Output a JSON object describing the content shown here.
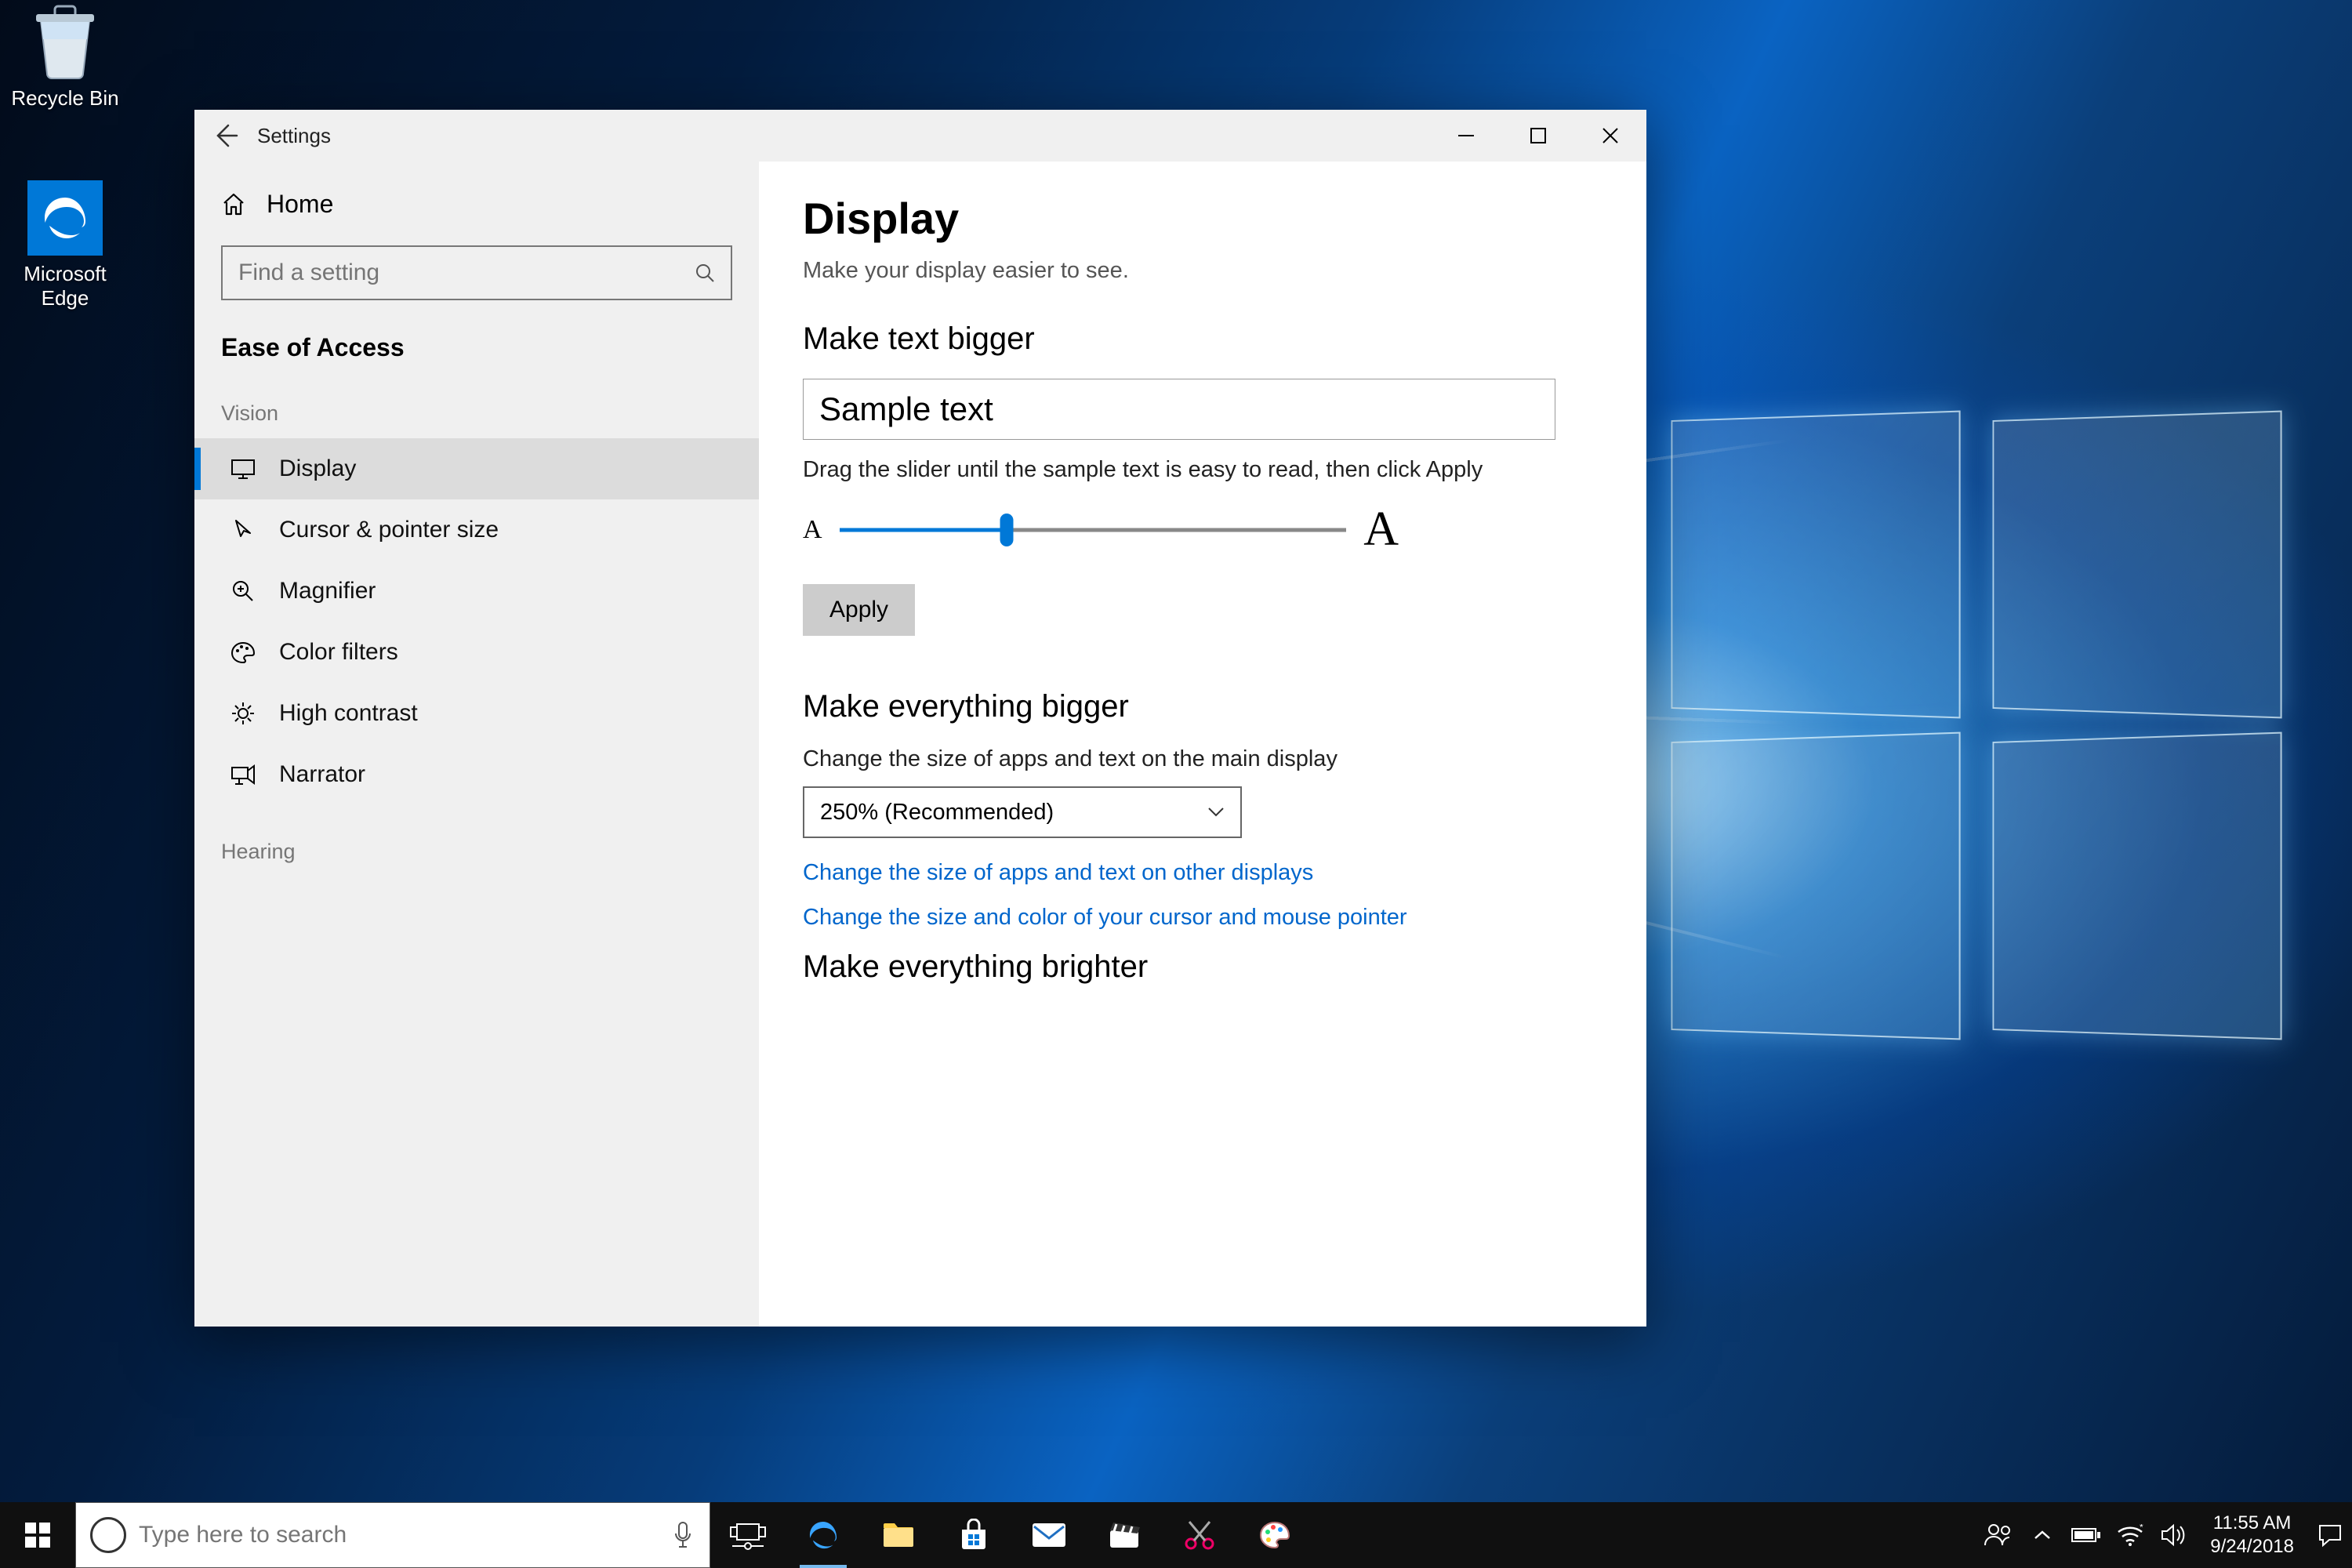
{
  "desktop": {
    "recycle_bin": "Recycle Bin",
    "edge": "Microsoft Edge"
  },
  "window": {
    "title": "Settings",
    "home": "Home",
    "search_placeholder": "Find a setting",
    "category": "Ease of Access",
    "groups": {
      "vision": "Vision",
      "hearing": "Hearing"
    },
    "nav": {
      "display": "Display",
      "cursor": "Cursor & pointer size",
      "magnifier": "Magnifier",
      "filters": "Color filters",
      "contrast": "High contrast",
      "narrator": "Narrator"
    },
    "main": {
      "h1": "Display",
      "subtitle": "Make your display easier to see.",
      "sec_text_bigger": "Make text bigger",
      "sample_text": "Sample text",
      "slider_hint": "Drag the slider until the sample text is easy to read, then click Apply",
      "small_a": "A",
      "big_a": "A",
      "apply": "Apply",
      "sec_everything_bigger": "Make everything bigger",
      "scale_desc": "Change the size of apps and text on the main display",
      "scale_value": "250% (Recommended)",
      "link_other_displays": "Change the size of apps and text on other displays",
      "link_cursor": "Change the size and color of your cursor and mouse pointer",
      "sec_brighter": "Make everything brighter"
    }
  },
  "taskbar": {
    "search_placeholder": "Type here to search",
    "time": "11:55 AM",
    "date": "9/24/2018"
  }
}
